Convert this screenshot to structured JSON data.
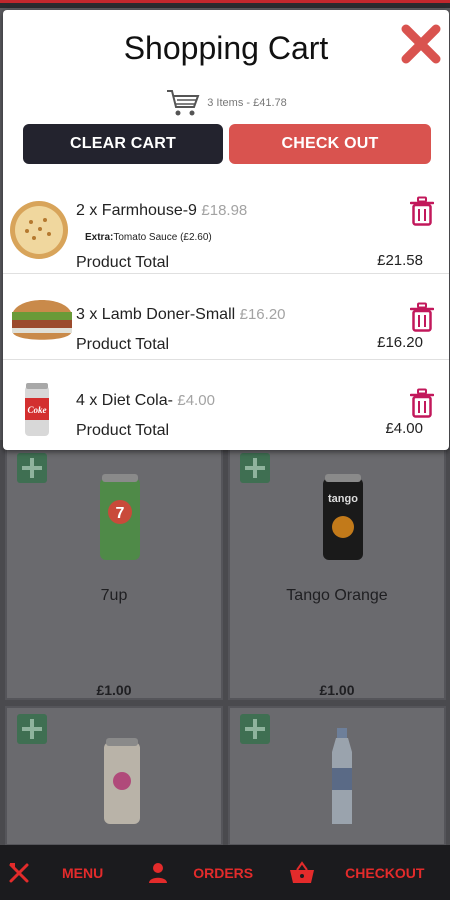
{
  "cart": {
    "title": "Shopping Cart",
    "summary": "3 Items - £41.78",
    "clear_label": "CLEAR CART",
    "checkout_label": "CHECK OUT",
    "product_total_label": "Product Total",
    "items": [
      {
        "line": "2 x Farmhouse-9",
        "price": "£18.98",
        "extra_label": "Extra:",
        "extra_value": "Tomato Sauce (£2.60)",
        "total": "£21.58"
      },
      {
        "line": "3 x Lamb Doner-Small",
        "price": "£16.20",
        "total": "£16.20"
      },
      {
        "line": "4 x Diet Cola-",
        "price": "£4.00",
        "total": "£4.00"
      }
    ]
  },
  "products": [
    {
      "name": "7up",
      "price": "£1.00"
    },
    {
      "name": "Tango Orange",
      "price": "£1.00"
    },
    {
      "name": "",
      "price": ""
    },
    {
      "name": "",
      "price": ""
    }
  ],
  "nav": {
    "menu_label": "MENU",
    "orders_label": "ORDERS",
    "checkout_label": "CHECKOUT"
  },
  "colors": {
    "accent_red": "#e32b2b",
    "checkout_button": "#d9534f",
    "clear_button": "#23232e",
    "trash_icon": "#c2185b"
  },
  "icons": {
    "close": "close-icon",
    "cart": "cart-icon",
    "trash": "trash-icon",
    "menu": "fork-knife-icon",
    "orders": "user-icon",
    "checkout": "basket-icon"
  }
}
